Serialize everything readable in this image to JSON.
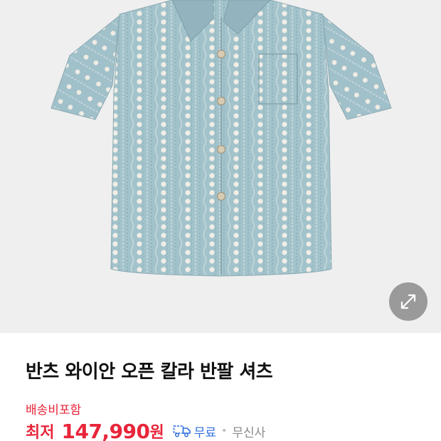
{
  "product": {
    "title": "반츠 와이안 오픈 칼라 반팔 셔츠",
    "image_icon": "shirt-image",
    "expand_icon": "expand-arrows-icon"
  },
  "shipping": {
    "label": "배송비포함"
  },
  "price": {
    "prefix": "최저",
    "value": "147,990",
    "unit": "원"
  },
  "delivery": {
    "icon": "delivery-truck-icon",
    "label": "무료",
    "color": "#2f6fe0"
  },
  "seller": {
    "name": "무신사"
  },
  "colors": {
    "accent": "#e8253a",
    "image_bg": "#efefef",
    "shirt": "#9fbfc9"
  }
}
